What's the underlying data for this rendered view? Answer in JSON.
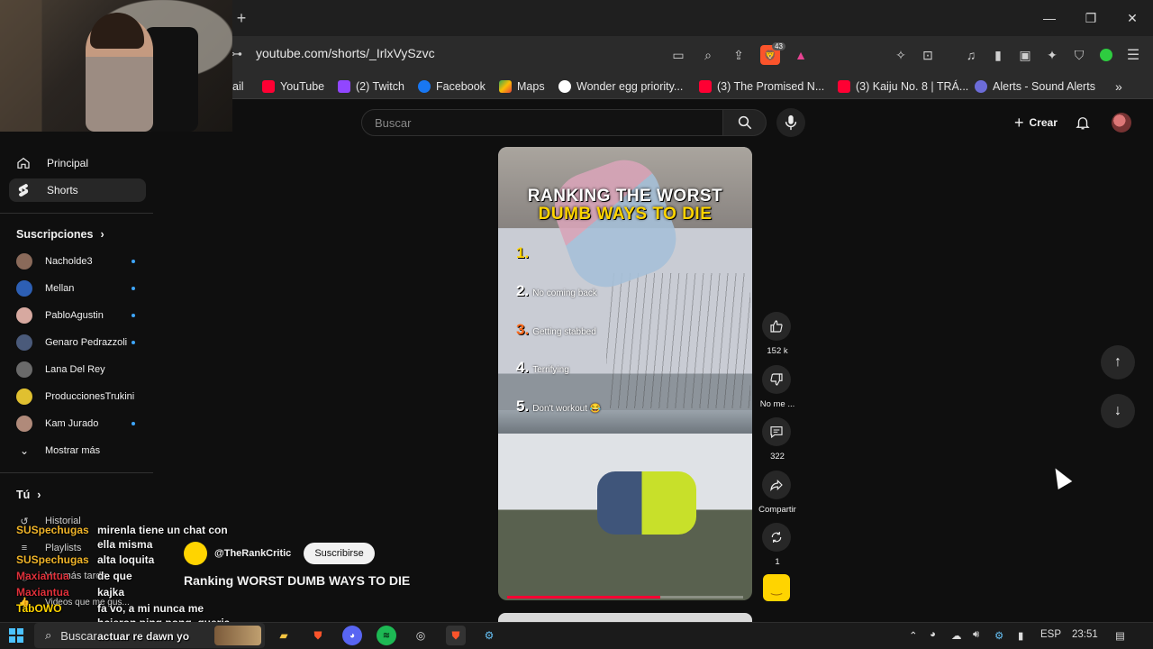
{
  "browser": {
    "url": "youtube.com/shorts/_IrlxVySzvc",
    "new_tab": "+",
    "extension_badge": "43",
    "window_controls": [
      "minimize",
      "restore",
      "close"
    ],
    "bookmarks": [
      {
        "label": "ail",
        "icon": "gmail-icon",
        "color": "#ea4335"
      },
      {
        "label": "YouTube",
        "icon": "youtube-icon",
        "color": "#ff0033"
      },
      {
        "label": "(2) Twitch",
        "icon": "twitch-icon",
        "color": "#9146ff"
      },
      {
        "label": "Facebook",
        "icon": "facebook-icon",
        "color": "#1877f2"
      },
      {
        "label": "Maps",
        "icon": "maps-icon",
        "color": "#34a853"
      },
      {
        "label": "Wonder egg priority...",
        "icon": "google-icon",
        "color": "#ffffff"
      },
      {
        "label": "(3) The Promised N...",
        "icon": "youtube-icon",
        "color": "#ff0033"
      },
      {
        "label": "(3) Kaiju No. 8 | TRÁ...",
        "icon": "youtube-icon",
        "color": "#ff0033"
      },
      {
        "label": "Alerts - Sound Alerts",
        "icon": "sound-alerts-icon",
        "color": "#6c6cd8"
      }
    ]
  },
  "header": {
    "search_placeholder": "Buscar",
    "create_label": "Crear"
  },
  "sidebar": {
    "main": [
      {
        "label": "Principal",
        "icon": "home-icon",
        "active": false
      },
      {
        "label": "Shorts",
        "icon": "shorts-icon",
        "active": true
      }
    ],
    "subscriptions_title": "Suscripciones",
    "subscriptions": [
      {
        "label": "Nacholde3",
        "color": "#8a6a5a",
        "new": true
      },
      {
        "label": "Mellan",
        "color": "#2d5fb4",
        "new": true
      },
      {
        "label": "PabloAgustin",
        "color": "#d7a9a0",
        "new": true
      },
      {
        "label": "Genaro Pedrazzoli",
        "color": "#4a5a7a",
        "new": true
      },
      {
        "label": "Lana Del Rey",
        "color": "#6a6a6a",
        "new": false
      },
      {
        "label": "ProduccionesTrukini",
        "color": "#e0c030",
        "new": false
      },
      {
        "label": "Kam Jurado",
        "color": "#b08a7a",
        "new": true
      }
    ],
    "show_more": "Mostrar más",
    "you_title": "Tú",
    "you_items": [
      {
        "label": "Historial",
        "icon": "history-icon"
      },
      {
        "label": "Playlists",
        "icon": "playlists-icon"
      },
      {
        "label": "Ver más tarde",
        "icon": "watch-later-icon"
      },
      {
        "label": "Videos que me gus...",
        "icon": "liked-icon"
      }
    ]
  },
  "short": {
    "title_line1": "RANKING THE WORST",
    "title_line2": "DUMB WAYS TO DIE",
    "ranks": [
      {
        "n": "1.",
        "text": "",
        "color": "#ffd400"
      },
      {
        "n": "2.",
        "text": "No coming back",
        "color": "#ffffff"
      },
      {
        "n": "3.",
        "text": "Getting stabbed",
        "color": "#ff6a1a"
      },
      {
        "n": "4.",
        "text": "Terrifying",
        "color": "#ffffff"
      },
      {
        "n": "5.",
        "text": "Don't workout 😂",
        "color": "#ffffff"
      }
    ],
    "progress": 0.65,
    "likes": "152 k",
    "dislike_label": "No me ...",
    "comments": "322",
    "share_label": "Compartir",
    "remix_count": "1",
    "channel": "@TheRankCritic",
    "subscribe_label": "Suscribirse",
    "video_title": "Ranking WORST DUMB WAYS TO DIE"
  },
  "chat": [
    {
      "user": "SUSpechugas",
      "color": "#f0b429",
      "msg": "mirenla tiene un chat con"
    },
    {
      "user": "",
      "color": "#f0b429",
      "msg": "ella misma"
    },
    {
      "user": "SUSpechugas",
      "color": "#f0b429",
      "msg": "alta loquita"
    },
    {
      "user": "Maxiantua",
      "color": "#e0303a",
      "msg": "de que"
    },
    {
      "user": "Maxiantua",
      "color": "#e0303a",
      "msg": "kajka"
    },
    {
      "user": "TabOWO",
      "color": "#ffd400",
      "msg": "fa vo, a mi nunca me"
    },
    {
      "user": "",
      "color": "#ffd400",
      "msg": "hcieron ping pong, queria"
    },
    {
      "user": "",
      "color": "#ffd400",
      "msg": "actuar re dawn yo"
    }
  ],
  "taskbar": {
    "search_label": "Buscar",
    "language": "ESP",
    "time": "23:51",
    "apps": [
      "files-icon",
      "brave-icon",
      "discord-icon",
      "spotify-icon",
      "obs-icon",
      "brave-active-icon",
      "steam-icon"
    ]
  }
}
